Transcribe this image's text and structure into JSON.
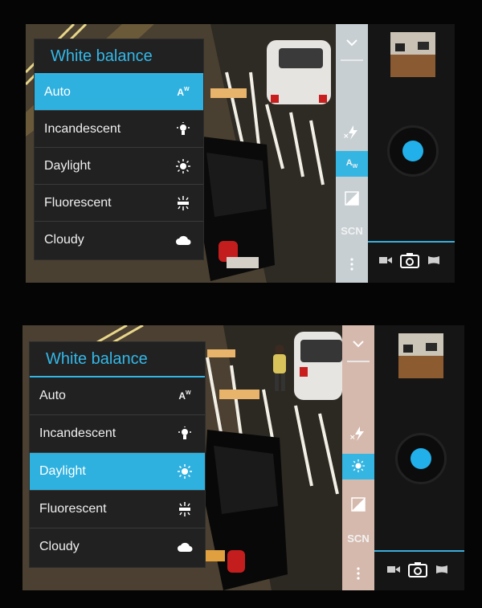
{
  "panels": [
    {
      "menu": {
        "title": "White balance",
        "items": [
          {
            "label": "Auto",
            "icon": "auto-wb-icon",
            "selected": true
          },
          {
            "label": "Incandescent",
            "icon": "incandescent-bulb-icon",
            "selected": false
          },
          {
            "label": "Daylight",
            "icon": "sun-icon",
            "selected": false
          },
          {
            "label": "Fluorescent",
            "icon": "fluorescent-icon",
            "selected": false
          },
          {
            "label": "Cloudy",
            "icon": "cloud-icon",
            "selected": false
          }
        ]
      },
      "side_rail": {
        "scene_label": "SCN",
        "active_setting": "white-balance-auto"
      },
      "rail_color": "#c7cfd3"
    },
    {
      "menu": {
        "title": "White balance",
        "items": [
          {
            "label": "Auto",
            "icon": "auto-wb-icon",
            "selected": false
          },
          {
            "label": "Incandescent",
            "icon": "incandescent-bulb-icon",
            "selected": false
          },
          {
            "label": "Daylight",
            "icon": "sun-icon",
            "selected": true
          },
          {
            "label": "Fluorescent",
            "icon": "fluorescent-icon",
            "selected": false
          },
          {
            "label": "Cloudy",
            "icon": "cloud-icon",
            "selected": false
          }
        ]
      },
      "side_rail": {
        "scene_label": "SCN",
        "active_setting": "white-balance-daylight"
      },
      "rail_color": "#d6b9ad"
    }
  ],
  "colors": {
    "accent": "#33b5e5",
    "menu_bg": "#212121",
    "shutter": "#22b0ea"
  }
}
